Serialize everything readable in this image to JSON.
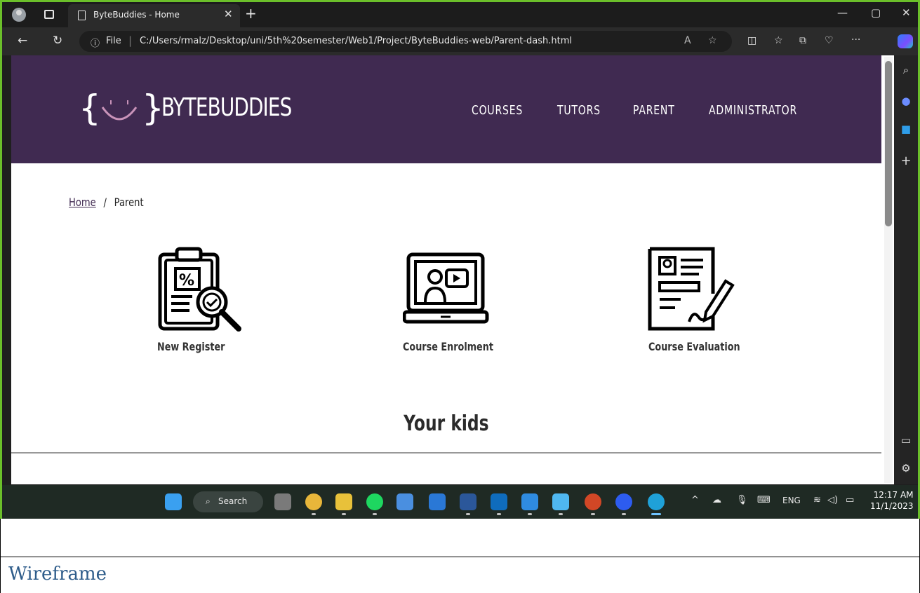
{
  "browser": {
    "tab_title": "ByteBuddies - Home",
    "address_prefix": "File",
    "url": "C:/Users/rmalz/Desktop/uni/5th%20semester/Web1/Project/ByteBuddies-web/Parent-dash.html"
  },
  "site": {
    "logo_text": "BYTEBUDDIES",
    "nav": [
      "COURSES",
      "TUTORS",
      "PARENT",
      "ADMINISTRATOR"
    ],
    "breadcrumb": {
      "home": "Home",
      "separator": "/",
      "current": "Parent"
    },
    "cards": [
      {
        "label": "New Register",
        "icon": "clipboard-search-icon"
      },
      {
        "label": "Course Enrolment",
        "icon": "laptop-video-icon"
      },
      {
        "label": "Course Evaluation",
        "icon": "document-sign-icon"
      }
    ],
    "kids_title": "Your kids",
    "colors": {
      "header": "#402a51",
      "logo_smile": "#c993b9"
    }
  },
  "taskbar": {
    "search_label": "Search",
    "language": "ENG",
    "time": "12:17 AM",
    "date": "11/1/2023"
  },
  "document": {
    "heading": "Wireframe"
  }
}
